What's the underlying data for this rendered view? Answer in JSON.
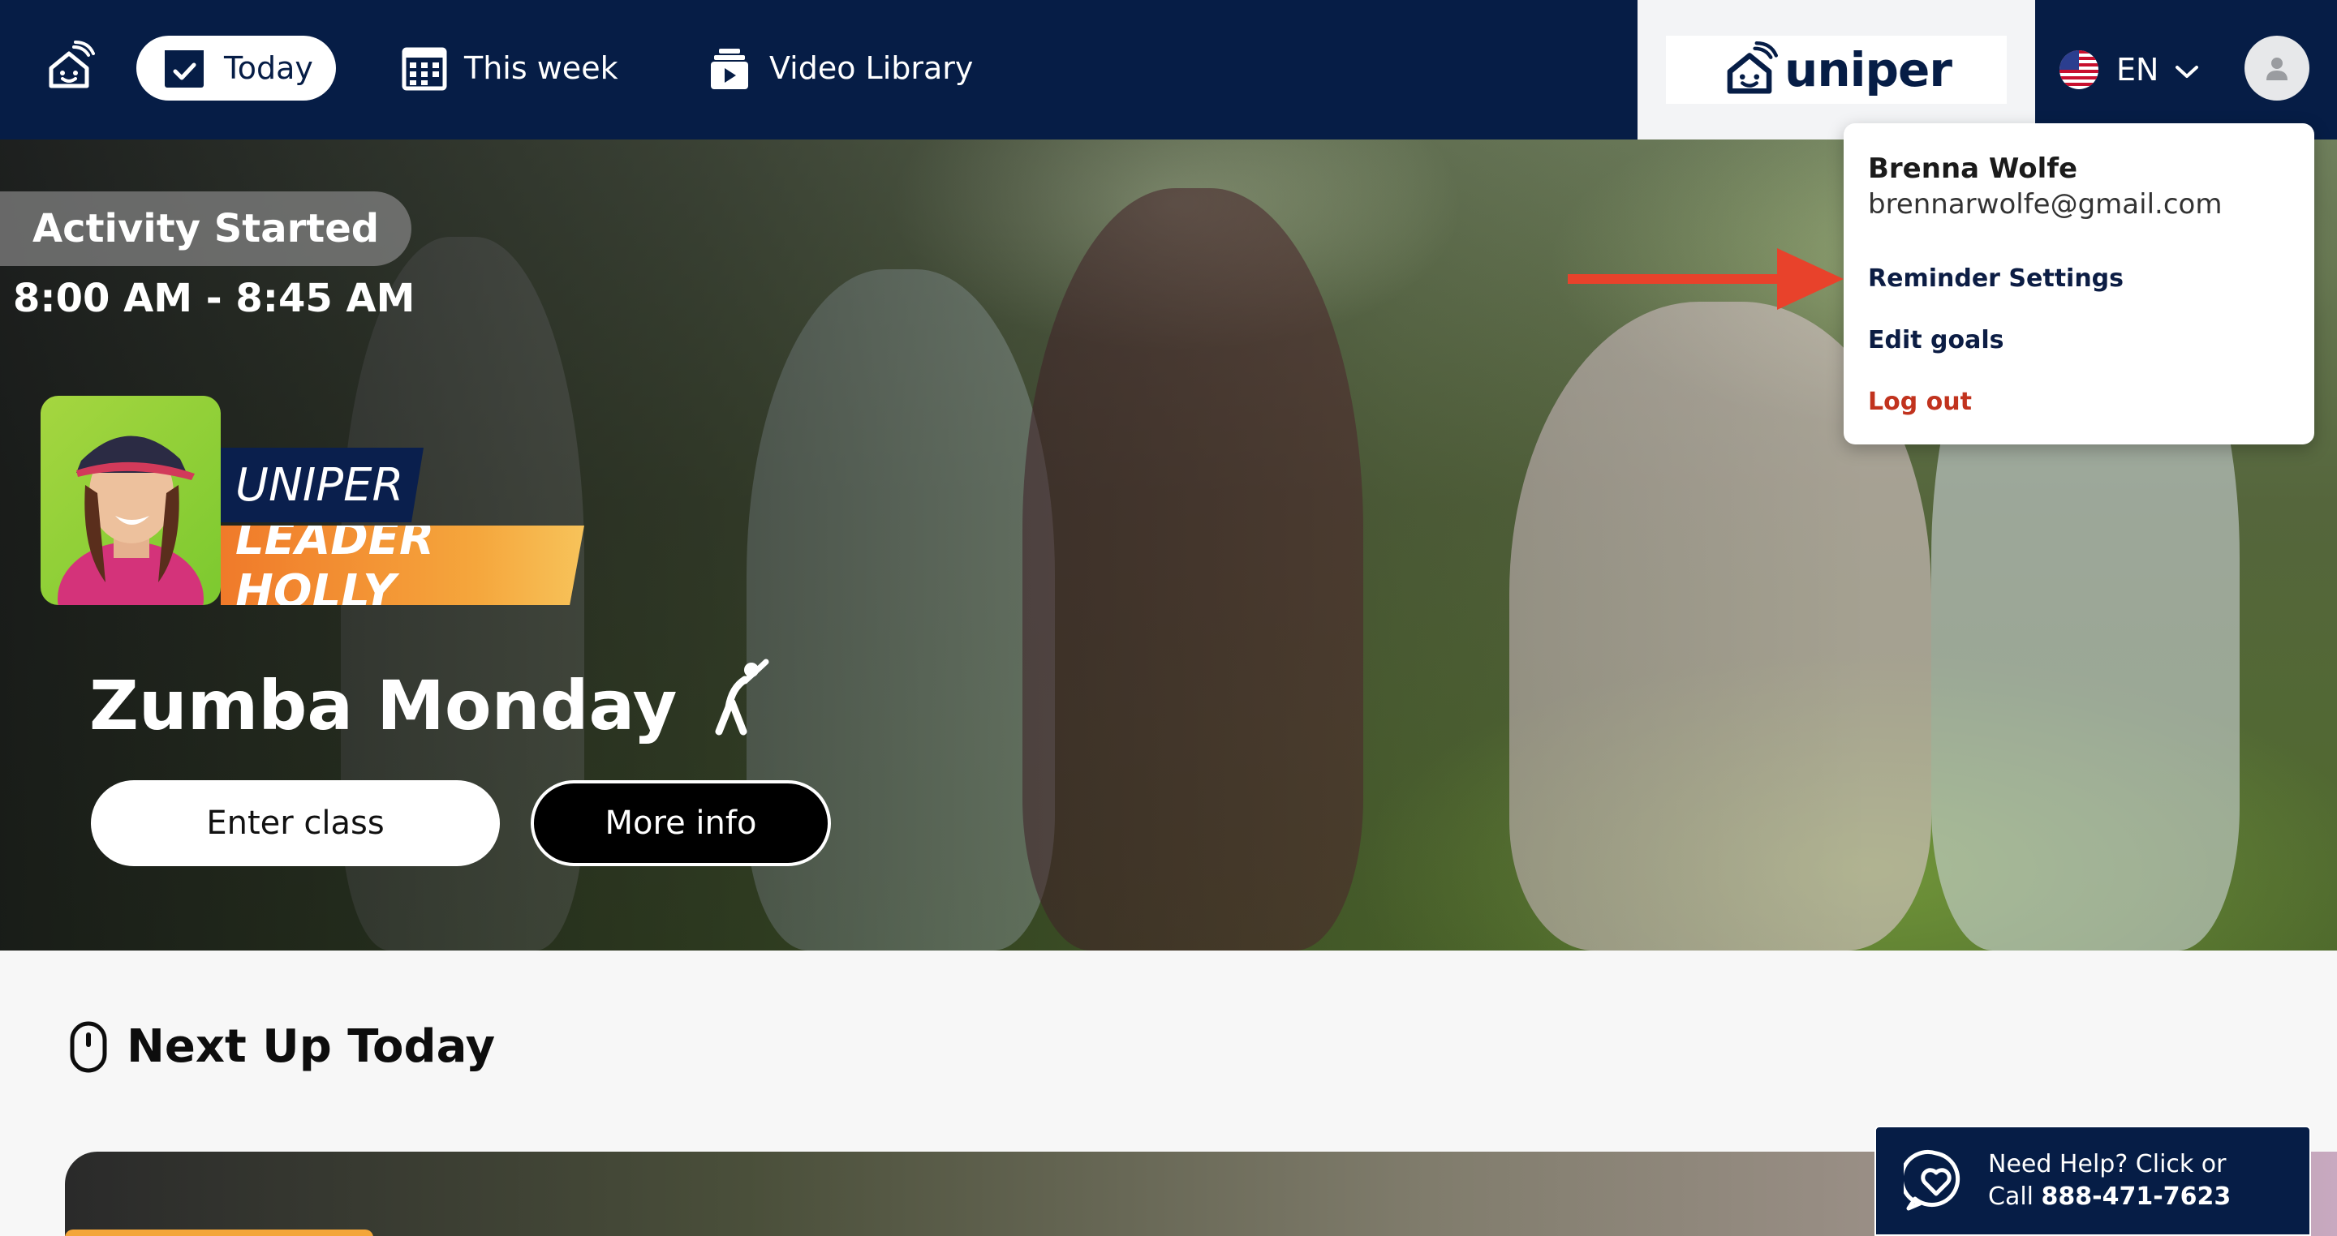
{
  "nav": {
    "today_label": "Today",
    "week_label": "This week",
    "video_label": "Video Library"
  },
  "logo": {
    "text": "uniper"
  },
  "language": {
    "code": "EN"
  },
  "hero": {
    "status_badge": "Activity Started",
    "time_range": "8:00 AM - 8:45 AM",
    "brand_tag": "UNIPER",
    "leader_tag": "LEADER HOLLY",
    "class_title": "Zumba Monday",
    "enter_label": "Enter class",
    "more_label": "More info"
  },
  "user_menu": {
    "name": "Brenna Wolfe",
    "email": "brennarwolfe@gmail.com",
    "reminder_label": "Reminder Settings",
    "goals_label": "Edit goals",
    "logout_label": "Log out"
  },
  "next_up": {
    "title": "Next Up Today"
  },
  "help": {
    "line1": "Need Help? Click or",
    "line2_prefix": "Call ",
    "phone": "888-471-7623"
  },
  "colors": {
    "navy": "#061d46",
    "logout_red": "#c1331e",
    "annotation_arrow": "#e8422b",
    "leader_orange": "#f07a2a"
  },
  "icons": [
    "uniper-home-icon",
    "calendar-check-icon",
    "calendar-grid-icon",
    "video-library-icon",
    "us-flag-icon",
    "chevron-down-icon",
    "user-avatar-icon",
    "stretch-figure-icon",
    "clock-icon",
    "heart-chat-icon",
    "annotation-arrow"
  ]
}
